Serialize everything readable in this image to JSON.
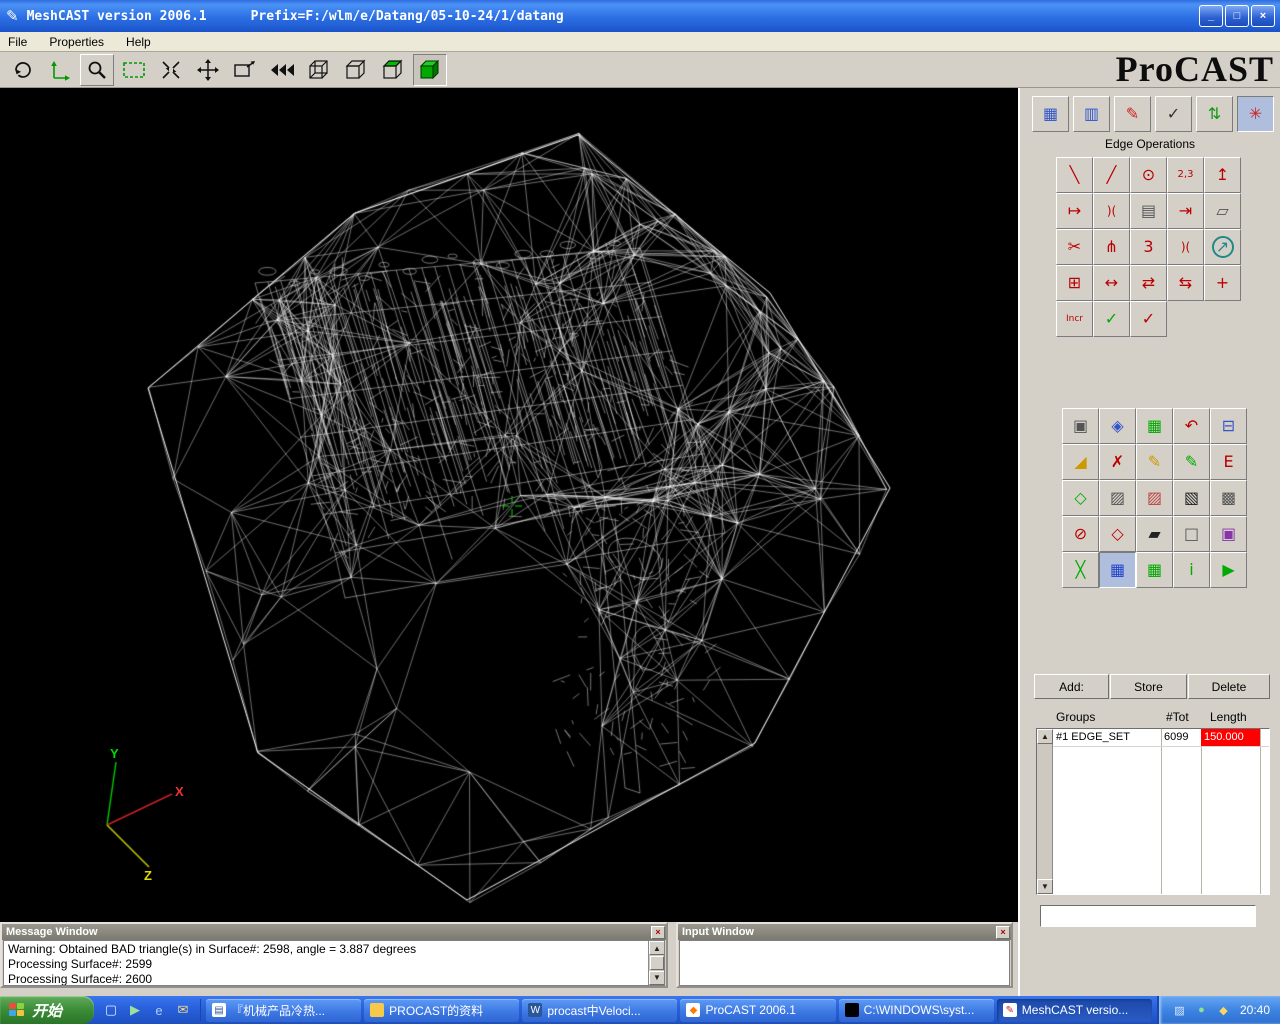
{
  "window": {
    "title": "MeshCAST version 2006.1",
    "prefix": "Prefix=F:/wlm/e/Datang/05-10-24/1/datang",
    "controls": [
      {
        "name": "minimize-button",
        "glyph": "_"
      },
      {
        "name": "maximize-button",
        "glyph": "□"
      },
      {
        "name": "close-button",
        "glyph": "×"
      }
    ]
  },
  "icons": {
    "up": "▲",
    "down": "▼",
    "close": "×",
    "app": "✎"
  },
  "menu": {
    "items": [
      "File",
      "Properties",
      "Help"
    ]
  },
  "logo": "ProCAST",
  "viewport": {
    "axes": {
      "x": "X",
      "y": "Y",
      "z": "Z"
    }
  },
  "right_panel": {
    "edge_operations_label": "Edge Operations",
    "top_icons": [
      {
        "name": "surface-mesh-icon",
        "g": "▦",
        "c": "#3355cc"
      },
      {
        "name": "volume-mesh-icon",
        "g": "▥",
        "c": "#3355cc"
      },
      {
        "name": "edit-mesh-icon",
        "g": "✎",
        "c": "#cc2222"
      },
      {
        "name": "check-mesh-icon",
        "g": "✓",
        "c": "#333333"
      },
      {
        "name": "import-export-icon",
        "g": "⇅",
        "c": "#119911"
      },
      {
        "name": "special-ops-icon",
        "g": "✳",
        "c": "#cc2222",
        "sel": "pressed"
      }
    ],
    "edge_ops_icons": [
      {
        "name": "edge-line-icon",
        "g": "╲",
        "c": "#bb0000"
      },
      {
        "name": "edge-segment-icon",
        "g": "╱",
        "c": "#bb0000"
      },
      {
        "name": "edge-circle-icon",
        "g": "⊙",
        "c": "#bb0000"
      },
      {
        "name": "edge-split-23-icon",
        "g": "2,3",
        "c": "#bb0000",
        "fs": 10
      },
      {
        "name": "edge-extend-icon",
        "g": "↥",
        "c": "#bb0000"
      },
      {
        "name": "edge-endpoints-icon",
        "g": "↦",
        "c": "#bb0000"
      },
      {
        "name": "edge-arcs-icon",
        "g": ")(",
        "c": "#bb0000",
        "fs": 12
      },
      {
        "name": "edge-copy-icon",
        "g": "▤",
        "c": "#555555"
      },
      {
        "name": "edge-snap-icon",
        "g": "⇥",
        "c": "#bb0000"
      },
      {
        "name": "edge-plane-icon",
        "g": "▱",
        "c": "#555555"
      },
      {
        "name": "edge-cut-icon",
        "g": "✂",
        "c": "#bb0000"
      },
      {
        "name": "edge-branch-icon",
        "g": "⋔",
        "c": "#bb0000"
      },
      {
        "name": "edge-split-3-icon",
        "g": "3",
        "c": "#bb0000"
      },
      {
        "name": "edge-join-icon",
        "g": ")(",
        "c": "#bb0000",
        "fs": 12
      },
      {
        "name": "edge-navigate-icon",
        "g": "↗",
        "c": "#1f8a8a",
        "sel": "circle"
      },
      {
        "name": "edge-corner-icon",
        "g": "⊞",
        "c": "#bb0000"
      },
      {
        "name": "edge-stretch-icon",
        "g": "↔",
        "c": "#bb0000"
      },
      {
        "name": "edge-swap-icon",
        "g": "⇄",
        "c": "#bb0000"
      },
      {
        "name": "edge-exchange-icon",
        "g": "⇆",
        "c": "#bb0000"
      },
      {
        "name": "edge-merge-icon",
        "g": "+",
        "c": "#bb0000"
      },
      {
        "name": "edge-incr-icon",
        "g": "Incr",
        "c": "#bb0000",
        "fs": 9
      },
      {
        "name": "edge-accept-icon",
        "g": "✓",
        "c": "#00aa00"
      },
      {
        "name": "edge-reject-icon",
        "g": "✓",
        "c": "#bb0000"
      }
    ],
    "mesh_ops_icons": [
      {
        "name": "mesh-cube-icon",
        "g": "▣",
        "c": "#555555"
      },
      {
        "name": "mesh-info-icon",
        "g": "◈",
        "c": "#3355cc"
      },
      {
        "name": "mesh-grid-green-icon",
        "g": "▦",
        "c": "#00aa00"
      },
      {
        "name": "mesh-undo-icon",
        "g": "↶",
        "c": "#bb0000"
      },
      {
        "name": "mesh-save-icon",
        "g": "⊟",
        "c": "#3355cc"
      },
      {
        "name": "mesh-wedge-icon",
        "g": "◢",
        "c": "#cc9900"
      },
      {
        "name": "mesh-delete-icon",
        "g": "✗",
        "c": "#bb0000"
      },
      {
        "name": "mesh-pencil-yellow-icon",
        "g": "✎",
        "c": "#cc9900"
      },
      {
        "name": "mesh-pencil-green-icon",
        "g": "✎",
        "c": "#00aa00"
      },
      {
        "name": "mesh-e-icon",
        "g": "E",
        "c": "#bb0000"
      },
      {
        "name": "mesh-dashed-diamond-icon",
        "g": "◇",
        "c": "#00aa00"
      },
      {
        "name": "mesh-hatch-icon",
        "g": "▨",
        "c": "#555555"
      },
      {
        "name": "mesh-hatch-red-icon",
        "g": "▨",
        "c": "#bb4444"
      },
      {
        "name": "mesh-hatch-dark-icon",
        "g": "▧",
        "c": "#222222"
      },
      {
        "name": "mesh-hatch-double-icon",
        "g": "▩",
        "c": "#555555"
      },
      {
        "name": "mesh-no-hatch-icon",
        "g": "⊘",
        "c": "#bb0000"
      },
      {
        "name": "mesh-diamond-arrows-icon",
        "g": "◇",
        "c": "#bb0000"
      },
      {
        "name": "mesh-flag-icon",
        "g": "▰",
        "c": "#222222"
      },
      {
        "name": "mesh-page-icon",
        "g": "□",
        "c": "#555555"
      },
      {
        "name": "mesh-page-purple-icon",
        "g": "▣",
        "c": "#8833aa"
      },
      {
        "name": "mesh-xgrid-green-icon",
        "g": "╳",
        "c": "#00aa00"
      },
      {
        "name": "mesh-xgrid-blue-icon",
        "g": "▦",
        "c": "#2244cc",
        "sel": "pressed"
      },
      {
        "name": "mesh-xgrid-green2-icon",
        "g": "▦",
        "c": "#00aa00"
      },
      {
        "name": "mesh-info2-icon",
        "g": "i",
        "c": "#00aa00"
      },
      {
        "name": "mesh-play-icon",
        "g": "▶",
        "c": "#00aa00"
      }
    ],
    "add_button": "Add:",
    "store_button": "Store",
    "delete_button": "Delete",
    "columns": [
      "Groups",
      "#Tot",
      "Length"
    ],
    "rows": [
      {
        "group": "#1 EDGE_SET",
        "tot": "6099",
        "length": "150.000"
      }
    ],
    "footer_input": ""
  },
  "message_window": {
    "title": "Message Window",
    "lines": [
      "Warning: Obtained BAD triangle(s) in Surface#: 2598, angle = 3.887 degrees",
      "Processing Surface#: 2599",
      "Processing Surface#: 2600"
    ]
  },
  "input_window": {
    "title": "Input Window",
    "content": ""
  },
  "taskbar": {
    "start_label": "开始",
    "quick_launch": [
      {
        "name": "quick-launch-desktop",
        "g": "▢",
        "c": "#dce9fb"
      },
      {
        "name": "quick-launch-player",
        "g": "▶",
        "c": "#9fe09f"
      },
      {
        "name": "quick-launch-browser",
        "g": "e",
        "c": "#aacdf7",
        "fs": 13
      },
      {
        "name": "quick-launch-mail",
        "g": "✉",
        "c": "#f2d98c"
      }
    ],
    "tasks": [
      {
        "label": "『机械产品冷热...",
        "g": "▤",
        "c": "#335a9e",
        "bg": "#ffffff"
      },
      {
        "label": "PROCAST的资料",
        "g": "",
        "c": "#000000",
        "bg": "#f7c94b"
      },
      {
        "label": "procast中Veloci...",
        "g": "W",
        "c": "#ffffff",
        "bg": "#2b579a"
      },
      {
        "label": "ProCAST 2006.1",
        "g": "◆",
        "c": "#ff7a00",
        "bg": "#ffffff"
      },
      {
        "label": "C:\\WINDOWS\\syst...",
        "g": "",
        "c": "#cccccc",
        "bg": "#000000"
      },
      {
        "label": "MeshCAST versio...",
        "g": "✎",
        "c": "#cc2222",
        "bg": "#ffffff",
        "active": true
      }
    ],
    "tray_icons": [
      {
        "name": "tray-icon-1",
        "g": "▨",
        "c": "#dce9fb"
      },
      {
        "name": "tray-icon-2",
        "g": "●",
        "c": "#8fe08f"
      },
      {
        "name": "tray-icon-3",
        "g": "◆",
        "c": "#ffd75e"
      }
    ],
    "time": "20:40"
  }
}
